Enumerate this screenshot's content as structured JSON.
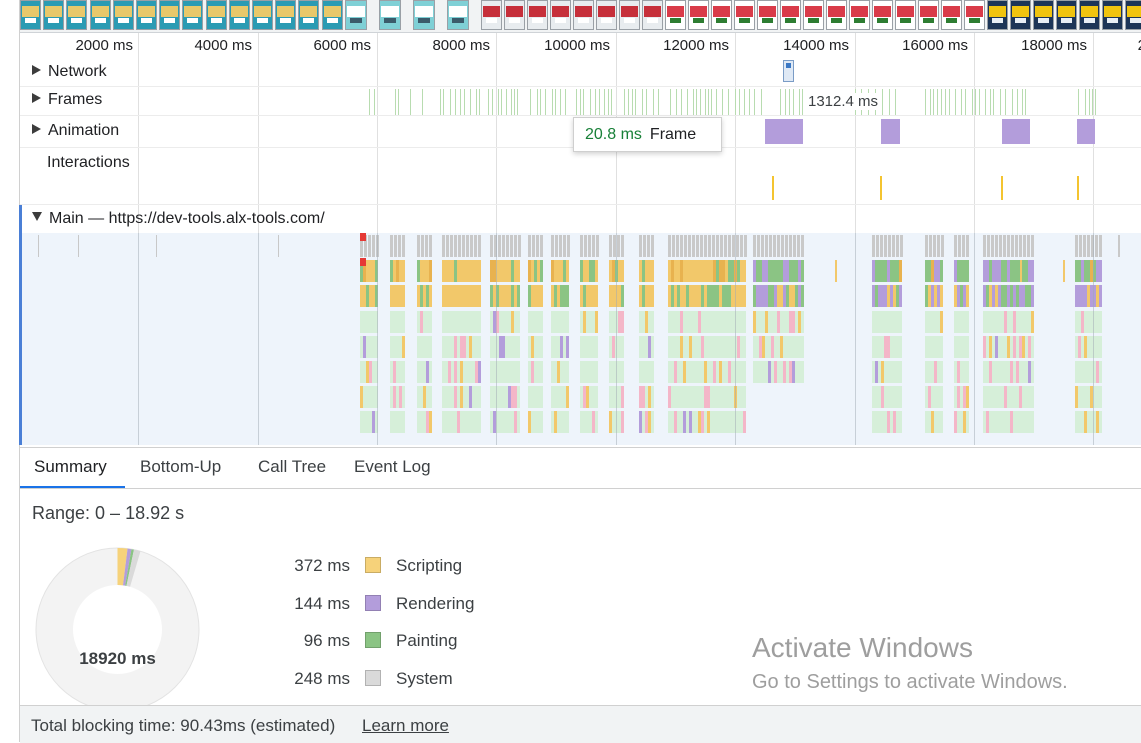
{
  "timeline": {
    "ticks": [
      "2000 ms",
      "4000 ms",
      "6000 ms",
      "8000 ms",
      "10000 ms",
      "12000 ms",
      "14000 ms",
      "16000 ms",
      "18000 ms",
      "2"
    ],
    "tracks": {
      "network": "Network",
      "frames": "Frames",
      "animation": "Animation",
      "interactions": "Interactions",
      "main": "Main — https://dev-tools.alx-tools.com/"
    },
    "frame_duration_label": "1312.4 ms",
    "tooltip": {
      "duration": "20.8 ms",
      "label": "Frame"
    }
  },
  "tabs": [
    "Summary",
    "Bottom-Up",
    "Call Tree",
    "Event Log"
  ],
  "active_tab": "Summary",
  "summary": {
    "range": "Range: 0 – 18.92 s",
    "total": "18920 ms",
    "categories": [
      {
        "ms": "372 ms",
        "name": "Scripting",
        "color": "#f6d27a"
      },
      {
        "ms": "144 ms",
        "name": "Rendering",
        "color": "#b39ddb"
      },
      {
        "ms": "96 ms",
        "name": "Painting",
        "color": "#8bc484"
      },
      {
        "ms": "248 ms",
        "name": "System",
        "color": "#dadada"
      }
    ],
    "idle_color": "#f3f3f3"
  },
  "watermark": {
    "line1": "Activate Windows",
    "line2": "Go to Settings to activate Windows."
  },
  "footer": {
    "text": "Total blocking time: 90.43ms (estimated)",
    "link": "Learn more"
  }
}
